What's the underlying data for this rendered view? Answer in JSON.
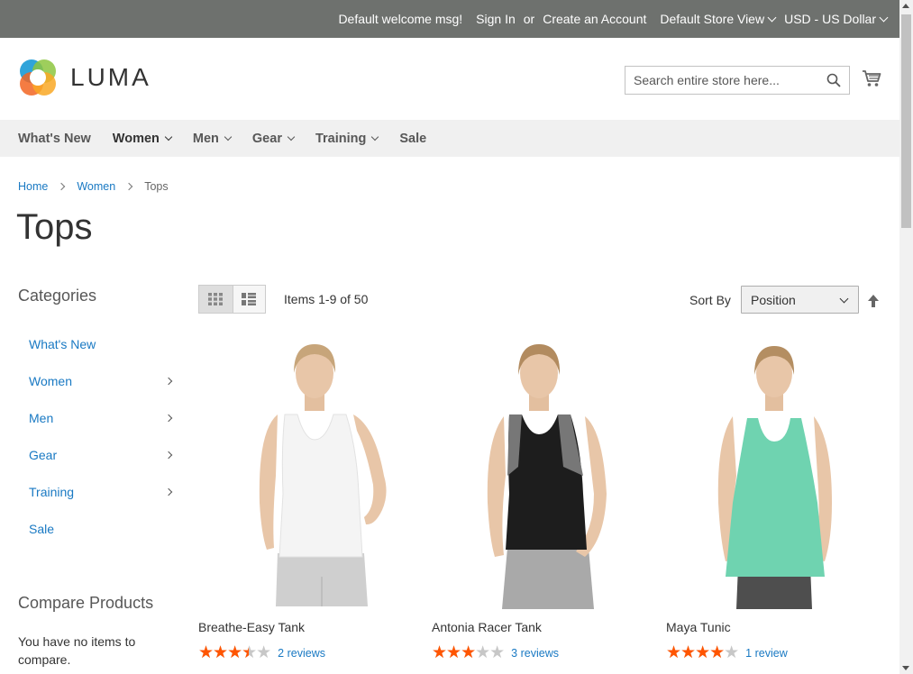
{
  "topbar": {
    "welcome": "Default welcome msg!",
    "sign_in": "Sign In",
    "or": "or",
    "create_account": "Create an Account",
    "store_view": "Default Store View",
    "currency": "USD - US Dollar",
    "bg_color": "#6e716e"
  },
  "header": {
    "logo_text": "LUMA",
    "search_placeholder": "Search entire store here...",
    "search_value": ""
  },
  "nav": {
    "items": [
      {
        "label": "What's New",
        "dropdown": false
      },
      {
        "label": "Women",
        "dropdown": true
      },
      {
        "label": "Men",
        "dropdown": true
      },
      {
        "label": "Gear",
        "dropdown": true
      },
      {
        "label": "Training",
        "dropdown": true
      },
      {
        "label": "Sale",
        "dropdown": false
      }
    ]
  },
  "breadcrumb": {
    "items": [
      "Home",
      "Women",
      "Tops"
    ]
  },
  "page": {
    "title": "Tops"
  },
  "sidebar": {
    "categories_title": "Categories",
    "categories": [
      {
        "label": "What's New",
        "has_children": false
      },
      {
        "label": "Women",
        "has_children": true
      },
      {
        "label": "Men",
        "has_children": true
      },
      {
        "label": "Gear",
        "has_children": true
      },
      {
        "label": "Training",
        "has_children": true
      },
      {
        "label": "Sale",
        "has_children": false
      }
    ],
    "compare_title": "Compare Products",
    "compare_text": "You have no items to compare."
  },
  "toolbar": {
    "view_mode": "grid",
    "items_count": "Items 1-9 of 50",
    "sort_label": "Sort By",
    "sort_value": "Position"
  },
  "products": [
    {
      "name": "Breathe-Easy Tank",
      "rating": 0.7,
      "reviews": "2 reviews",
      "top_color": "#f7f7f7",
      "bottom_color": "#c9c9c9",
      "style": "tank"
    },
    {
      "name": "Antonia Racer Tank",
      "rating": 0.6,
      "reviews": "3 reviews",
      "top_color": "#1d1d1d",
      "bottom_color": "#b5b5b5",
      "style": "racer"
    },
    {
      "name": "Maya Tunic",
      "rating": 0.8,
      "reviews": "1 review",
      "top_color": "#6fd3b0",
      "bottom_color": "#555555",
      "style": "tunic"
    }
  ],
  "colors": {
    "link": "#1979c3",
    "star": "#ff5501",
    "star_empty": "#c7c7c7",
    "nav_bg": "#f0f0f0"
  }
}
